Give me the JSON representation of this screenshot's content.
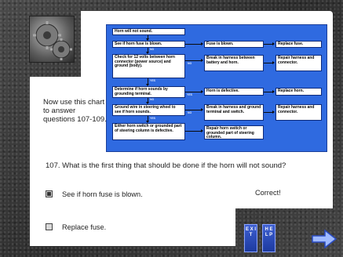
{
  "flowchart": {
    "boxes": {
      "start": "Horn will not sound.",
      "check_fuse": "See if horn fuse is blown.",
      "fuse_blown": "Fuse is blown.",
      "replace_fuse": "Replace fuse.",
      "check_12v": "Check for 12 volts between horn connector (power source) and ground (body).",
      "break_battery": "Break in harness between battery and horn.",
      "repair_1": "Repair harness and connector.",
      "determine": "Determine if horn sounds by grounding terminal.",
      "horn_defective": "Horn is defective.",
      "replace_horn": "Replace horn.",
      "ground_wire": "Ground wire in steering wheel to see if horn sounds.",
      "break_ground": "Break in harness and ground terminal and switch.",
      "repair_2": "Repair harness and connector.",
      "either": "Either horn switch or grounded part of steering column is defective.",
      "repair_switch": "Repair horn switch or grounded part of steering column."
    },
    "labels": {
      "yes": "YES",
      "no": "NO"
    }
  },
  "instructions": "Now use this chart to answer questions 107-109.",
  "question": "107.  What is the first thing that should be done if the horn will not sound?",
  "options": [
    {
      "label": "See if horn fuse is blown.",
      "checked": true
    },
    {
      "label": "Replace fuse.",
      "checked": false
    }
  ],
  "feedback": "Correct!",
  "buttons": {
    "exit": "E X I T",
    "help": "H E L P"
  },
  "icons": {
    "next": "arrow-right-icon",
    "thumbnail": "gears-icon"
  },
  "colors": {
    "chart_bg": "#2f6ae0",
    "button_bg": "#2a4bc0",
    "arrow": "#8fb0ff"
  }
}
